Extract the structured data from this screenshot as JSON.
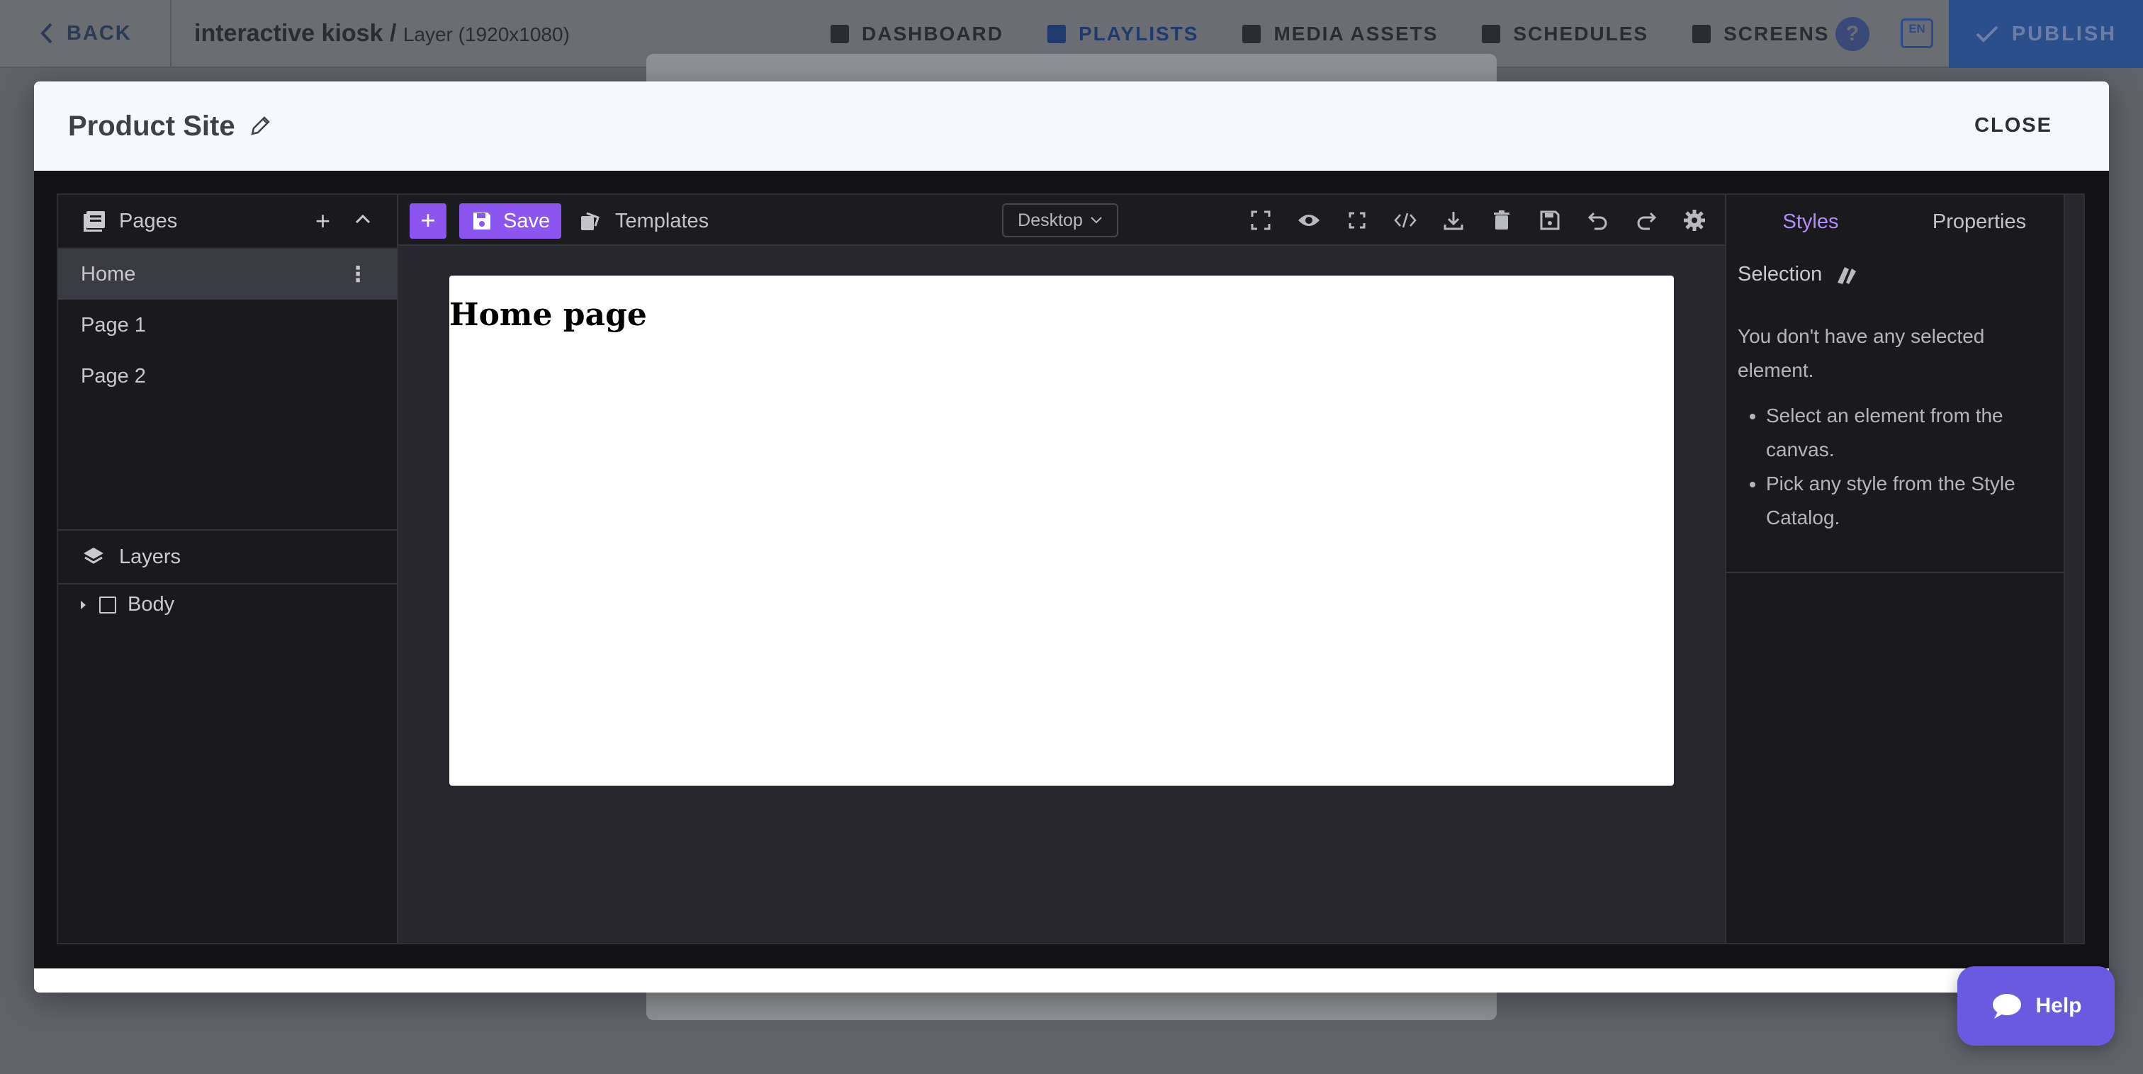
{
  "topbar": {
    "back_label": "BACK",
    "project": "interactive kiosk",
    "separator": "/",
    "layer": "Layer (1920x1080)",
    "nav": [
      {
        "label": "DASHBOARD",
        "icon": "dashboard-icon"
      },
      {
        "label": "PLAYLISTS",
        "icon": "playlist-icon"
      },
      {
        "label": "MEDIA ASSETS",
        "icon": "media-icon"
      },
      {
        "label": "SCHEDULES",
        "icon": "calendar-icon"
      },
      {
        "label": "SCREENS",
        "icon": "screen-icon"
      }
    ],
    "help_glyph": "?",
    "language": "EN",
    "publish_label": "PUBLISH"
  },
  "modal": {
    "title": "Product Site",
    "close_label": "CLOSE"
  },
  "pages_panel": {
    "title": "Pages",
    "pages": [
      "Home",
      "Page 1",
      "Page 2"
    ],
    "selected": "Home"
  },
  "layers_panel": {
    "title": "Layers",
    "root": "Body"
  },
  "toolbar": {
    "add_glyph": "+",
    "save_label": "Save",
    "templates_label": "Templates",
    "device": "Desktop"
  },
  "canvas": {
    "heading": "Home page"
  },
  "right_panel": {
    "tabs": [
      "Styles",
      "Properties"
    ],
    "active_tab": "Styles",
    "selection_label": "Selection",
    "empty_message": "You don't have any selected element.",
    "tips": [
      "Select an element from the canvas.",
      "Pick any style from the Style Catalog."
    ]
  },
  "help_button": {
    "label": "Help"
  },
  "colors": {
    "accent": "#8c55f0",
    "help": "#6a5ae0",
    "publish": "#2c4f8c"
  }
}
